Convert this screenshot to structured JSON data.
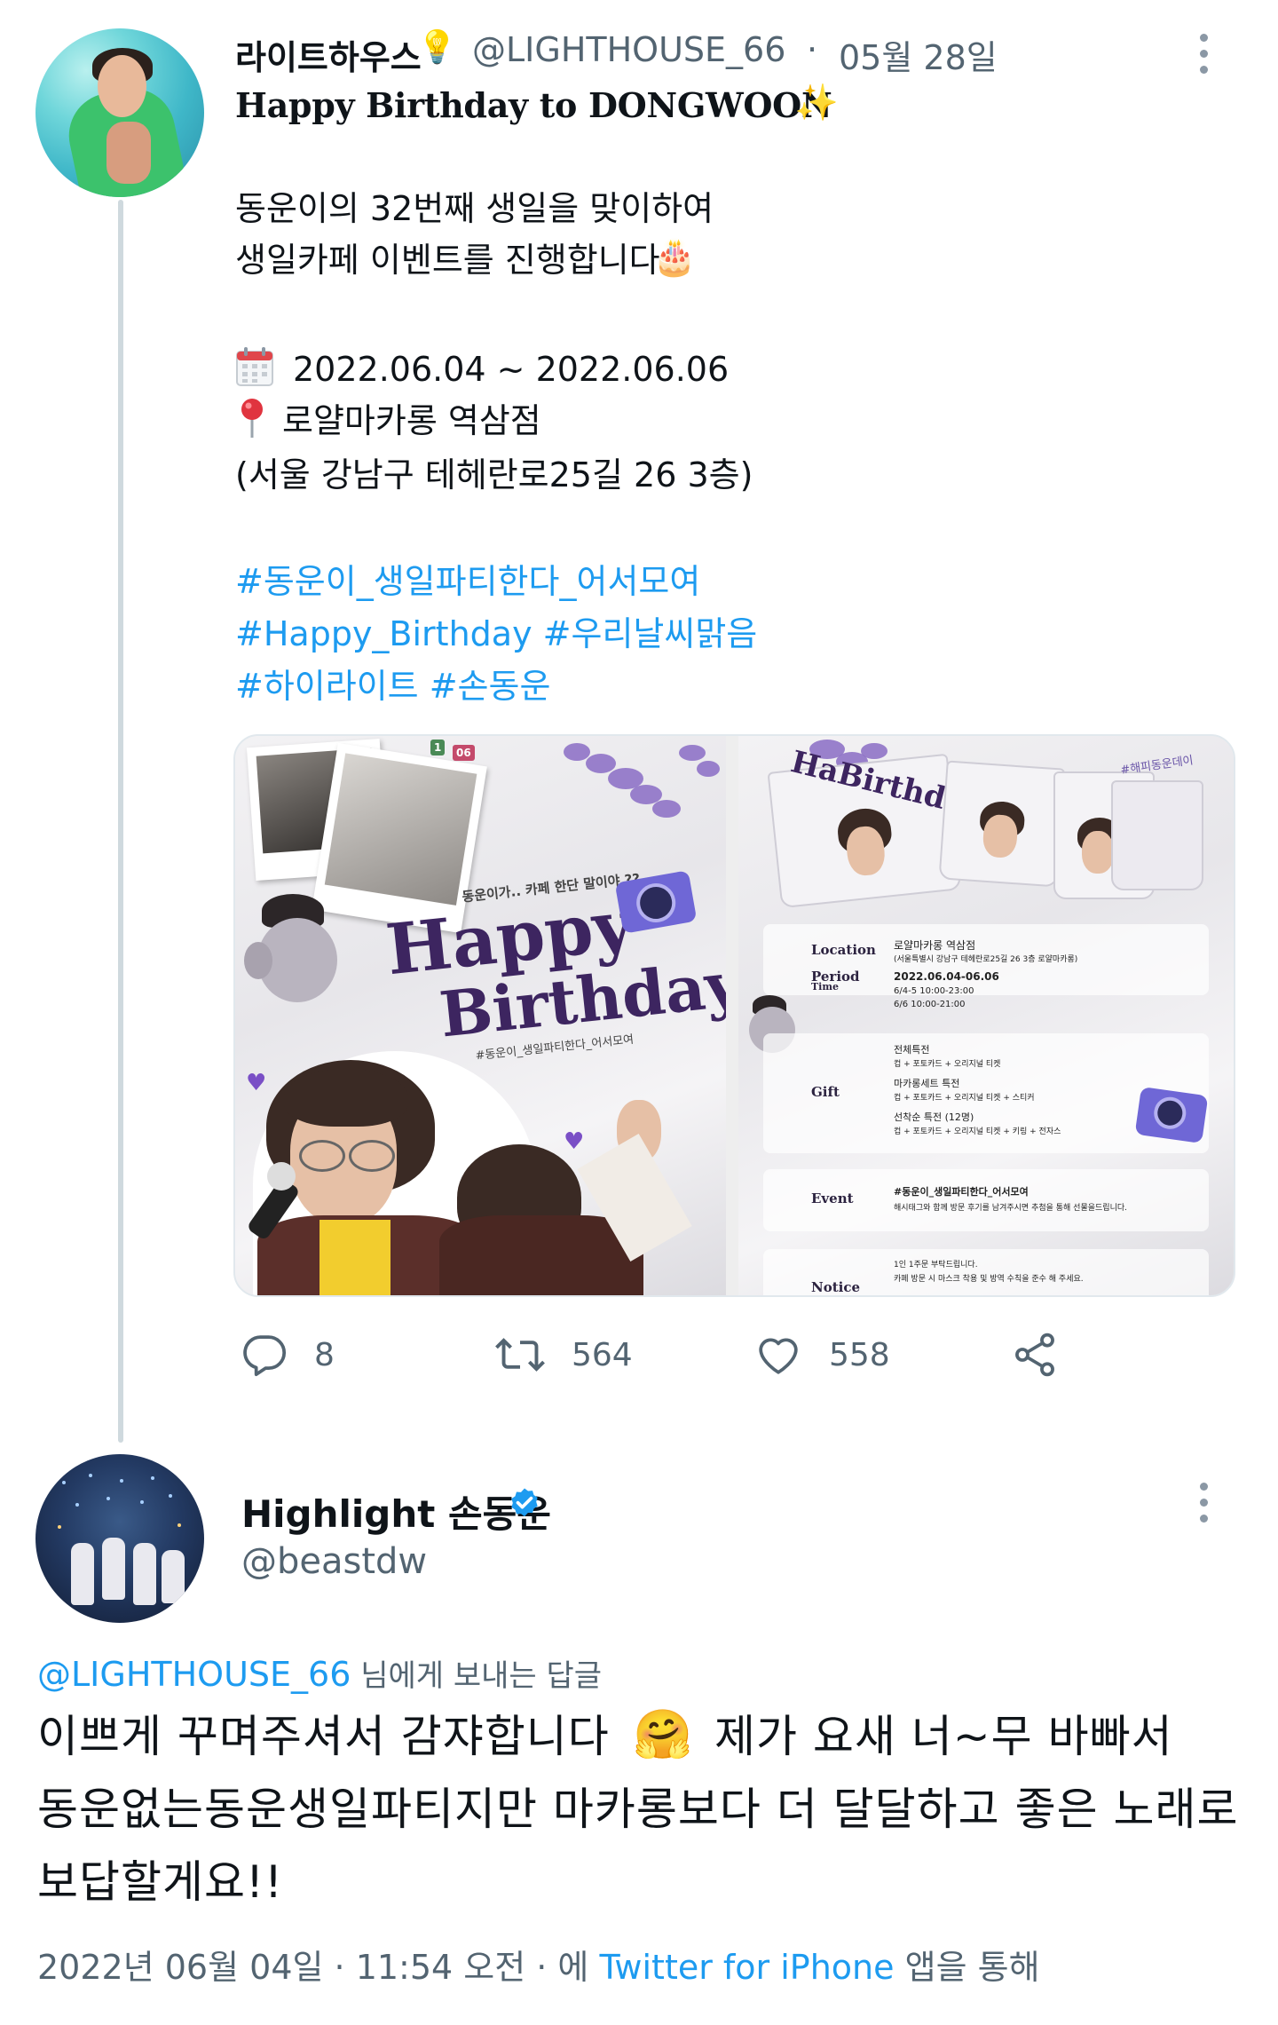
{
  "tweet1": {
    "author_name": "라이트하우스",
    "author_emoji": "💡",
    "handle": "@LIGHTHOUSE_66",
    "separator": "·",
    "date": "05월 28일",
    "title": "Happy Birthday to DONGWOON",
    "title_emoji": "✨",
    "body_line1": "동운이의 32번째 생일을 맞이하여",
    "body_line2": "생일카페 이벤트를 진행합니다",
    "body_line2_emoji": "🎂",
    "dates": "2022.06.04 ~ 2022.06.06",
    "venue": "로얄마카롱 역삼점",
    "address": "(서울 강남구 테헤란로25길 26 3층)",
    "hashtags_line1": "#동운이_생일파티한다_어서모여",
    "hashtags_line2": "#Happy_Birthday #우리날씨맑음",
    "hashtags_line3": "#하이라이트 #손동운",
    "poster1": {
      "tagline": "동운이가.. 카페 한단 말이야 ??",
      "headline1": "Happy",
      "headline2": "Birthday",
      "hashtag": "#동운이_생일파티한다_어서모여"
    },
    "poster2": {
      "cup_tag": "#해피동운데이",
      "location_label": "Location",
      "location_name": "로얄마카롱 역삼점",
      "location_addr": "(서울특별시 강남구 테헤란로25길 26 3층 로얄마카롱)",
      "period_label": "Period",
      "time_label": "Time",
      "period_range": "2022.06.04-06.06",
      "period_hours1": "6/4-5   10:00-23:00",
      "period_hours2": "6/6     10:00-21:00",
      "gift_label": "Gift",
      "gift1_title": "전체특전",
      "gift1_desc": "컵 + 포토카드 + 오리지널 티켓",
      "gift2_title": "마카롱세트 특전",
      "gift2_desc": "컵 + 포토카드 + 오리지널 티켓 + 스티커",
      "gift3_title": "선착순 특전 (12명)",
      "gift3_desc": "컵 + 포토카드 + 오리지널 티켓 + 키링 + 전자스",
      "event_label": "Event",
      "event_title": "#동운이_생일파티한다_어서모여",
      "event_desc": "해시태그와 함께 방문 후기를 남겨주시면 추첨을 통해 선물을드립니다.",
      "notice_label": "Notice",
      "notice1": "1인 1주문 부탁드립니다.",
      "notice2": "카페 방문 시 마스크 착용 및 방역 수칙을 준수 해 주세요."
    },
    "counts": {
      "replies": "8",
      "retweets": "564",
      "likes": "558"
    }
  },
  "tweet2": {
    "author_name": "Highlight 손동운",
    "handle": "@beastdw",
    "replying_to_handle": "@LIGHTHOUSE_66",
    "replying_to_suffix": " 님에게 보내는 답글",
    "line1": "이쁘게 꾸며주셔서 감쟈합니다",
    "line1_emoji": "🤗",
    "line1_tail": "제가 요새 너~무 바빠서",
    "line2": "동운없는동운생일파티지만 마카롱보다 더 달달하고 좋은 노래로",
    "line3": "보답할게요!!",
    "meta_time": "2022년 06월 04일 · 11:54 오전 · 에 ",
    "meta_client": "Twitter for iPhone",
    "meta_suffix": " 앱을 통해"
  },
  "colors": {
    "link": "#1d9bf0",
    "muted": "#536471",
    "thread_line": "#cfd9de",
    "verified": "#1d9bf0",
    "poster_purple": "#3d2560"
  },
  "icons": [
    "calendar-icon",
    "pin-icon",
    "reply-icon",
    "retweet-icon",
    "like-icon",
    "share-icon",
    "more-icon",
    "verified-badge-icon"
  ]
}
